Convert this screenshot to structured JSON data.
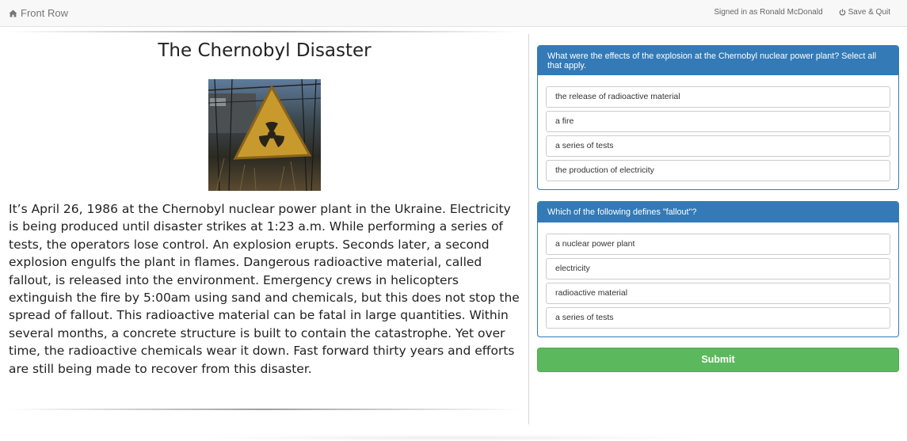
{
  "navbar": {
    "brand_label": "Front Row",
    "brand_icon": "home-icon",
    "signed_in_text": "Signed in as Ronald McDonald",
    "save_quit_label": "Save & Quit",
    "save_quit_icon": "power-icon"
  },
  "article": {
    "title": "The Chernobyl Disaster",
    "image_icon": "radiation-sign-photo",
    "body": "It’s April 26, 1986 at the Chernobyl nuclear power plant in the Ukraine. Electricity is being produced until disaster strikes at 1:23 a.m. While performing a series of tests, the operators lose control. An explosion erupts. Seconds later, a second explosion engulfs the plant in flames. Dangerous radioactive material, called fallout, is released into the environment. Emergency crews in helicopters extinguish the fire by 5:00am using sand and chemicals, but this does not stop the spread of fallout. This radioactive material can be fatal in large quantities. Within several months, a concrete structure is built to contain the catastrophe. Yet over time, the radioactive chemicals wear it down. Fast forward thirty years and efforts are still being made to recover from this disaster."
  },
  "questions": [
    {
      "prompt": "What were the effects of the explosion at the Chernobyl nuclear power plant? Select all that apply.",
      "options": [
        "the release of radioactive material",
        "a fire",
        "a series of tests",
        "the production of electricity"
      ]
    },
    {
      "prompt": "Which of the following defines \"fallout\"?",
      "options": [
        "a nuclear power plant",
        "electricity",
        "radioactive material",
        "a series of tests"
      ]
    }
  ],
  "submit_label": "Submit",
  "colors": {
    "primary": "#337ab7",
    "success": "#5cb85c",
    "navbar_bg": "#f8f8f8"
  }
}
